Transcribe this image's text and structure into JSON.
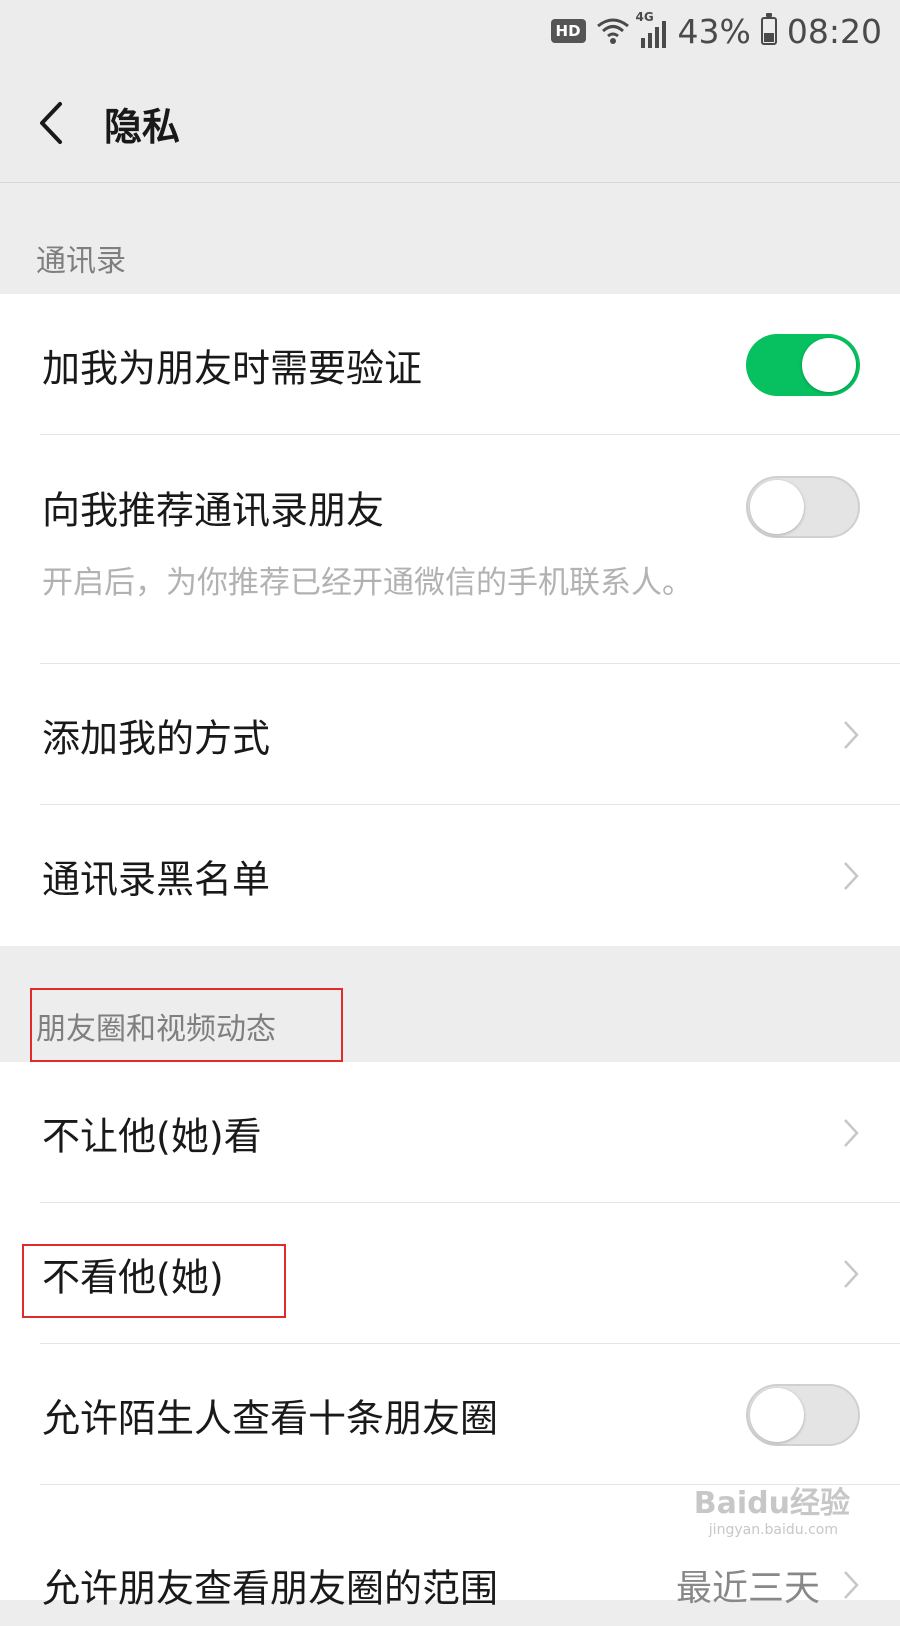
{
  "status_bar": {
    "hd": "HD",
    "network": "4G",
    "battery_percent": "43%",
    "battery_level": 0.43,
    "time": "08:20"
  },
  "nav": {
    "title": "隐私"
  },
  "contacts_section": {
    "header": "通讯录",
    "require_verification": {
      "label": "加我为朋友时需要验证",
      "enabled": true
    },
    "recommend_contacts": {
      "label": "向我推荐通讯录朋友",
      "enabled": false,
      "hint": "开启后，为你推荐已经开通微信的手机联系人。"
    },
    "add_methods": {
      "label": "添加我的方式"
    },
    "blacklist": {
      "label": "通讯录黑名单"
    }
  },
  "moments_section": {
    "header": "朋友圈和视频动态",
    "hide_my_posts": {
      "label": "不让他(她)看"
    },
    "hide_their_posts": {
      "label": "不看他(她)"
    },
    "stranger_ten_posts": {
      "label": "允许陌生人查看十条朋友圈",
      "enabled": false
    },
    "visible_range": {
      "label": "允许朋友查看朋友圈的范围",
      "value": "最近三天"
    }
  },
  "watermark": {
    "text": "Baidu经验",
    "sub": "jingyan.baidu.com"
  },
  "colors": {
    "toggle_on": "#07c160",
    "highlight": "#e02b2b",
    "background": "#ededed"
  }
}
